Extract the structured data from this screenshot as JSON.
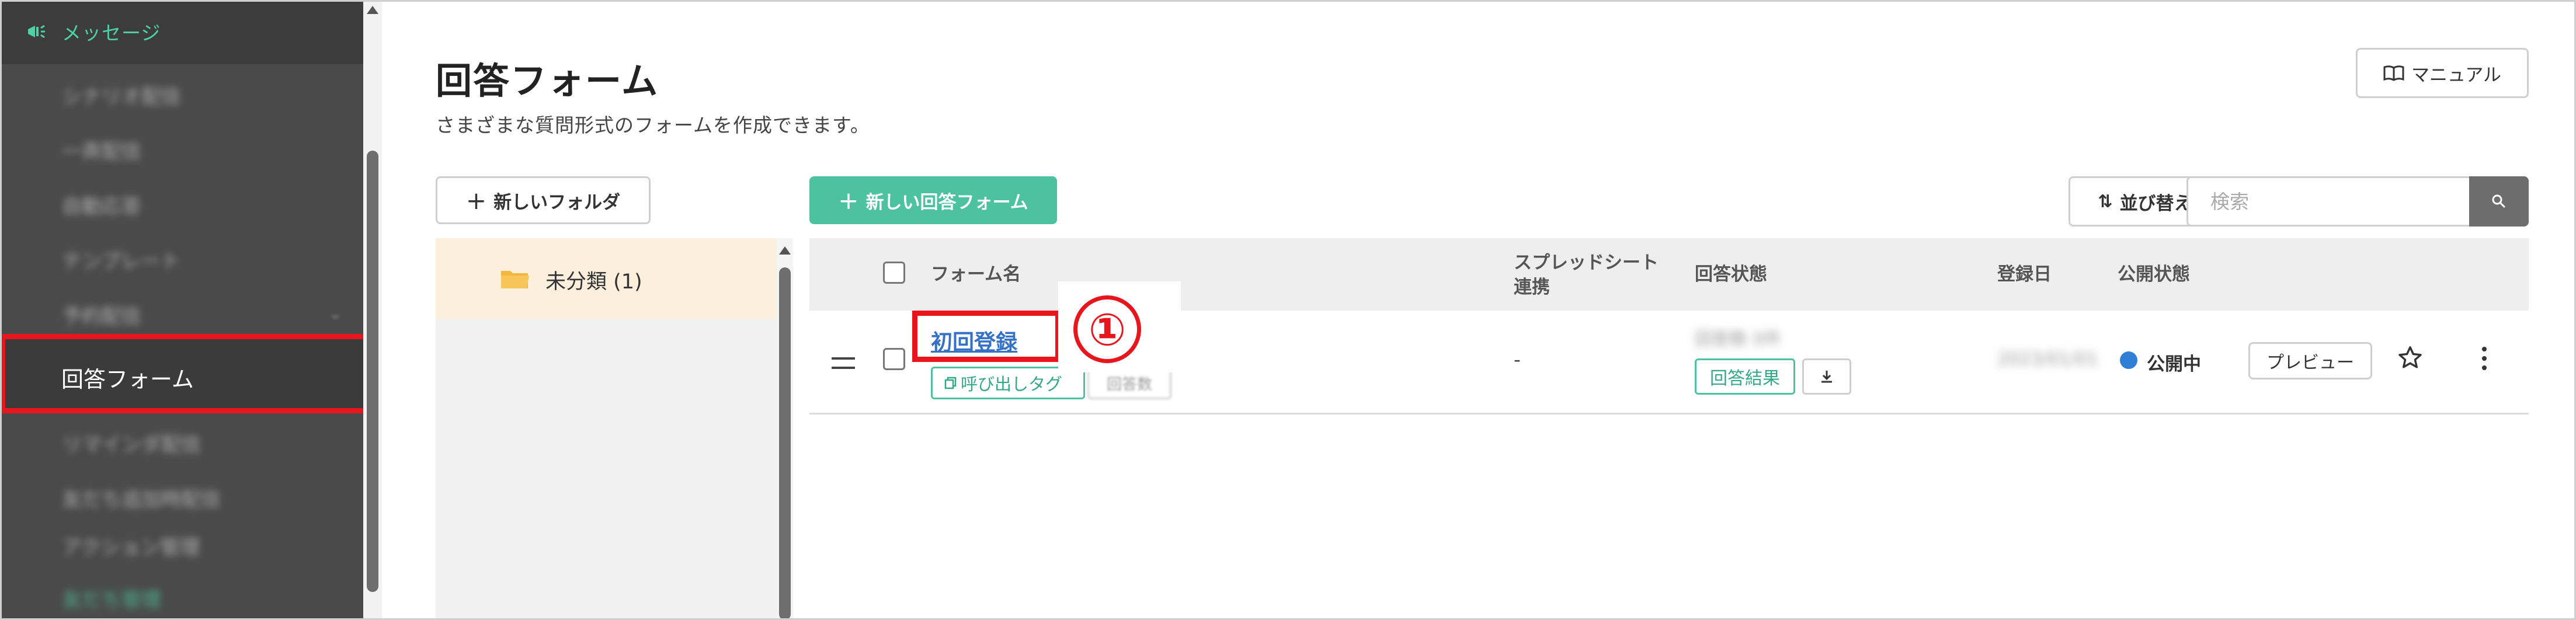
{
  "sidebar": {
    "header_label": "メッセージ",
    "items": [
      {
        "label": "シナリオ配信"
      },
      {
        "label": "一斉配信"
      },
      {
        "label": "自動応答"
      },
      {
        "label": "テンプレート"
      },
      {
        "label": "予約配信"
      },
      {
        "label": "回答フォーム"
      },
      {
        "label": "リマインダ配信"
      },
      {
        "label": "友だち追加時配信"
      },
      {
        "label": "アクション管理"
      },
      {
        "label": "友だち管理"
      }
    ]
  },
  "page": {
    "title": "回答フォーム",
    "subtitle": "さまざまな質問形式のフォームを作成できます。"
  },
  "toolbar": {
    "manual_label": "マニュアル",
    "new_folder_label": "新しいフォルダ",
    "new_form_label": "新しい回答フォーム",
    "sort_label": "並び替え",
    "search_placeholder": "検索"
  },
  "folders": [
    {
      "name": "未分類 (1)"
    }
  ],
  "table": {
    "headers": {
      "form_name": "フォーム名",
      "spreadsheet_line1": "スプレッドシート",
      "spreadsheet_line2": "連携",
      "answer_status": "回答状態",
      "registered_date": "登録日",
      "publish_status": "公開状態"
    },
    "rows": [
      {
        "form_name": "初回登録",
        "tag_button": "呼び出しタグ",
        "secondary_tag": "回答数",
        "spreadsheet": "-",
        "answer_summary": "回答数 0件",
        "answer_result_label": "回答結果",
        "registered_date": "2023/01/01",
        "publish_status": "公開中",
        "preview_label": "プレビュー"
      }
    ]
  },
  "annotation": {
    "step_number": "①"
  },
  "colors": {
    "accent_green": "#4cc2a0",
    "highlight_red": "#e8151c",
    "link_blue": "#3572c6",
    "status_blue": "#2f7fd6"
  }
}
